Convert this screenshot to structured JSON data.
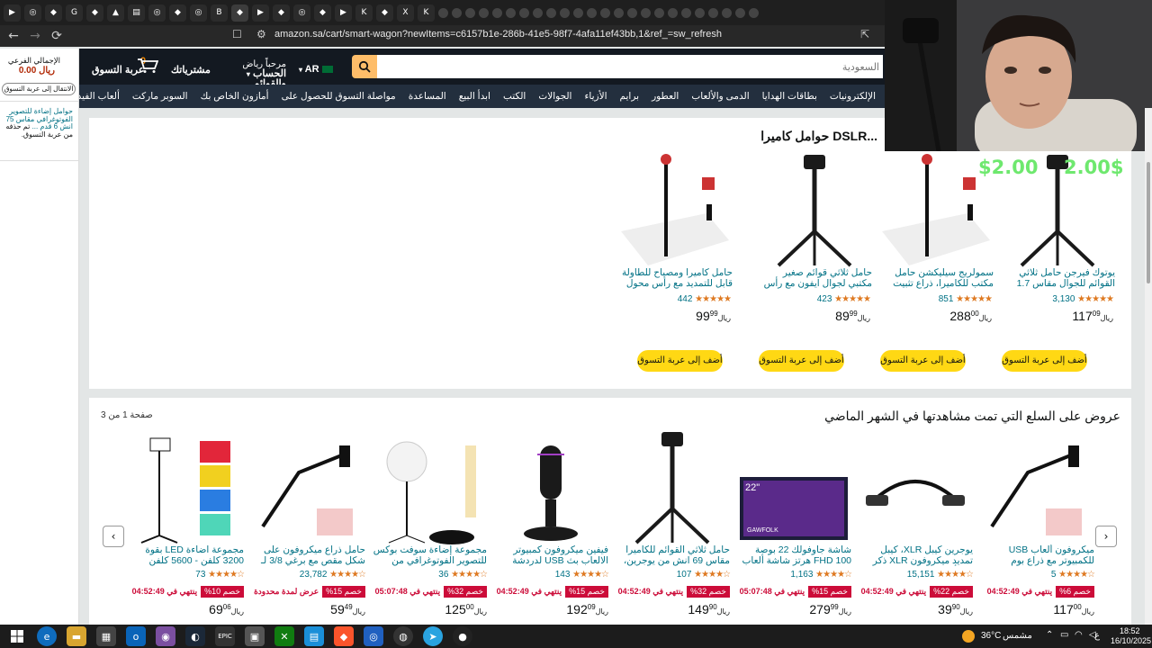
{
  "browser": {
    "url": "amazon.sa/cart/smart-wagon?newItems=c6157b1e-286b-41e5-98f7-4afa11ef43bb,1&ref_=sw_refresh",
    "tabs": [
      "▶",
      "◎",
      "◆",
      "G",
      "◆",
      "▲",
      "▤",
      "◎",
      "◆",
      "◎",
      "B",
      "◆",
      "▶",
      "◆",
      "◎",
      "◆",
      "▶",
      "K",
      "◆",
      "X",
      "K"
    ]
  },
  "header": {
    "search_placeholder": "السعودية",
    "language": "AR",
    "account_greeting": "مرحباً رياض",
    "account_label": "الحساب والقوائم",
    "orders_label": "مشترياتك",
    "cart_count": "0",
    "cart_label": "عربة التسوق"
  },
  "subnav": [
    "الإلكترونيات",
    "بطاقات الهدايا",
    "الدمى والألعاب",
    "العطور",
    "برايم",
    "الأزياء",
    "الجوالات",
    "الكتب",
    "ابدأ البيع",
    "المساعدة",
    "مواصلة التسوق للحصول على",
    "أمازون الخاص بك",
    "السوبر ماركت",
    "ألعاب الفيديو",
    "الأجهزة المنزلية"
  ],
  "left_panel": {
    "subtotal_label": "الإجمالي الفرعي",
    "subtotal_value": "0.00 ريال",
    "go_to_cart": "الانتقال إلى عربة التسوق",
    "item_link": "حوامل إضاءة للتصوير الفوتوغرافي مقاس 75 انش 6 قدم ...",
    "item_status": "تم حذفه من عربة التسوق."
  },
  "section1": {
    "title": "...DSLR حوامل كاميرا",
    "add_label": "أضف إلى عربة التسوق",
    "products": [
      {
        "title": "يوتوك فيرجن حامل ثلاثي القوائم للجوال مقاس 1.7 متر/67 انش و...",
        "reviews": "3,130",
        "price_main": "117",
        "price_frac": "09",
        "currency": "ريال"
      },
      {
        "title": "سمولريج سيليكشن حامل مكتب للكاميرا، ذراع تثبيت بمشبك C ل...",
        "reviews": "851",
        "price_main": "288",
        "price_frac": "00",
        "currency": "ريال"
      },
      {
        "title": "حامل ثلاثي قوائم صغير مكتبي لجوال ايفون مع رأس كروي 360°...",
        "reviews": "423",
        "price_main": "89",
        "price_frac": "99",
        "currency": "ريال"
      },
      {
        "title": "حامل كاميرا ومصباح للطاولة قابل للتمديد مع رأس محول كروي لول...",
        "reviews": "442",
        "price_main": "99",
        "price_frac": "99",
        "currency": "ريال"
      }
    ]
  },
  "section2": {
    "title": "عروض على السلع التي تمت مشاهدتها في الشهر الماضي",
    "page": "صفحة 1 من 3",
    "products": [
      {
        "title": "ميكروفون ألعاب USB للكمبيوتر مع ذراع بوم وميكروفون مكثف باضاء...",
        "reviews": "5",
        "badge": "خصم 6%",
        "deal": "ينتهي في 04:52:49",
        "price_main": "117",
        "price_frac": "00",
        "currency": "ريال"
      },
      {
        "title": "يوجرين كيبل XLR، كيبل تمديد ميكروفون XLR ذكر إلى أنثى 1 م...",
        "reviews": "15,151",
        "badge": "خصم 22%",
        "deal": "ينتهي في 04:52:49",
        "price_main": "39",
        "price_frac": "90",
        "currency": "ريال"
      },
      {
        "title": "شاشة جاوفولك 22 بوصة FHD 100 هرتز شاشة ألعاب 1080P (...",
        "reviews": "1,163",
        "badge": "خصم 15%",
        "deal": "ينتهي في 05:07:48",
        "price_main": "279",
        "price_frac": "99",
        "currency": "ريال"
      },
      {
        "title": "حامل ثلاثي القوائم للكاميرا مقاس 69 انش من يوجرين، حامل ثلاثي ا...",
        "reviews": "107",
        "badge": "خصم 32%",
        "deal": "ينتهي في 04:52:49",
        "price_main": "149",
        "price_frac": "90",
        "currency": "ريال"
      },
      {
        "title": "فيفين ميكروفون كمبيوتر الالعاب بث USB لدردشة العاب البودكا...",
        "reviews": "143",
        "badge": "خصم 15%",
        "deal": "ينتهي في 04:52:49",
        "price_main": "192",
        "price_frac": "09",
        "currency": "ريال"
      },
      {
        "title": "مجموعة إضاءة سوفت بوكس للتصوير الفوتوغرافي من جلانفين...",
        "reviews": "36",
        "badge": "خصم 32%",
        "deal": "ينتهي في 05:07:48",
        "price_main": "125",
        "price_frac": "00",
        "currency": "ريال"
      },
      {
        "title": "حامل ذراع ميكروفون على شكل مقص مع برغي 3/8 لـ 5/8 بوصة...",
        "reviews": "23,782",
        "badge": "خصم 15%",
        "deal": "عرض لمدة محدودة",
        "price_main": "59",
        "price_frac": "49",
        "currency": "ريال"
      },
      {
        "title": "مجموعة اضاءة LED بقوة 3200 كلفن - 5600 كلفن للتصوير الفو...",
        "reviews": "73",
        "badge": "خصم 10%",
        "deal": "ينتهي في 04:52:49",
        "price_main": "69",
        "price_frac": "06",
        "currency": "ريال"
      }
    ]
  },
  "overlay": {
    "price_left": "$2.00",
    "price_right": "2.00$"
  },
  "taskbar": {
    "weather": "36°C",
    "weather_label": "مشمس",
    "time": "18:52",
    "date": "16/10/2025",
    "lang": "ع"
  },
  "colors": {
    "amazon_dark": "#131921",
    "amazon_nav": "#232f3e",
    "deal_red": "#cc0c39",
    "button_yellow": "#ffd814",
    "link": "#007185"
  }
}
